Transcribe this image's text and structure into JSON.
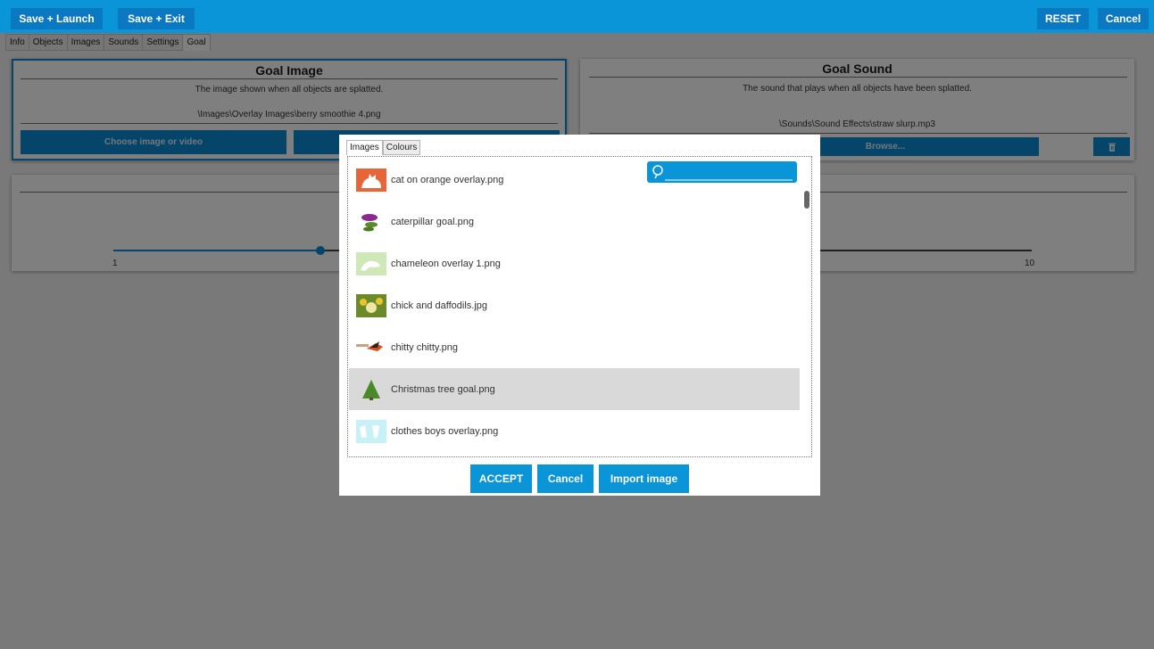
{
  "toolbar": {
    "save_launch": "Save + Launch",
    "save_exit": "Save + Exit",
    "reset": "RESET",
    "cancel": "Cancel"
  },
  "tabs": [
    "Info",
    "Objects",
    "Images",
    "Sounds",
    "Settings",
    "Goal"
  ],
  "active_tab": "Goal",
  "goal_image": {
    "title": "Goal Image",
    "description": "The image shown when all objects are splatted.",
    "path": "\\Images\\Overlay Images\\berry smoothie 4.png",
    "choose_button": "Choose image or video"
  },
  "goal_sound": {
    "title": "Goal Sound",
    "description": "The sound that plays when all objects have been splatted.",
    "path": "\\Sounds\\Sound Effects\\straw slurp.mp3",
    "browse_button": "Browse..."
  },
  "slider": {
    "min_label": "1",
    "max_label": "10"
  },
  "dialog": {
    "tabs": [
      "Images",
      "Colours"
    ],
    "active_tab": "Images",
    "search_value": "",
    "items": [
      {
        "label": "cat on orange overlay.png",
        "icon": "cat-thumbnail"
      },
      {
        "label": "caterpillar goal.png",
        "icon": "caterpillar-thumbnail"
      },
      {
        "label": "chameleon overlay 1.png",
        "icon": "chameleon-thumbnail"
      },
      {
        "label": "chick and daffodils.jpg",
        "icon": "chick-thumbnail"
      },
      {
        "label": "chitty chitty.png",
        "icon": "bird-thumbnail"
      },
      {
        "label": "Christmas tree goal.png",
        "icon": "tree-thumbnail"
      },
      {
        "label": "clothes boys overlay.png",
        "icon": "clothes-thumbnail"
      }
    ],
    "selected_index": 5,
    "accept": "ACCEPT",
    "cancel": "Cancel",
    "import": "Import image"
  },
  "colors": {
    "topbar": "#0a95d9",
    "button": "#0b79c2",
    "accent": "#0b8ad3",
    "selection": "#d9d9d9"
  }
}
